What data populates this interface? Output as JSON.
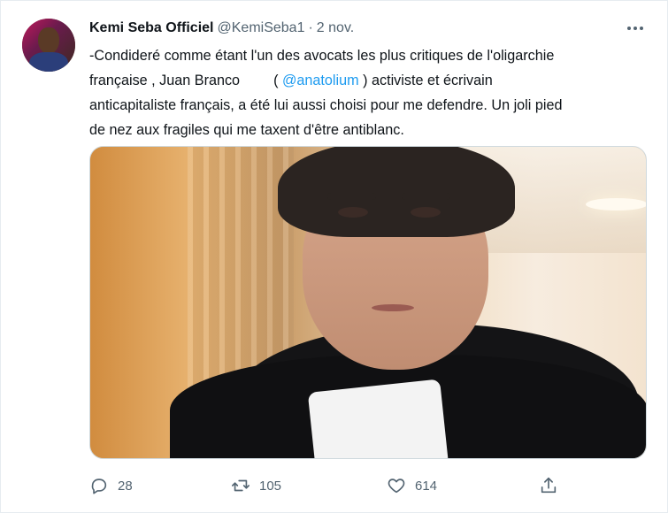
{
  "tweet": {
    "author_name": "Kemi Seba Officiel",
    "handle": "@KemiSeba1",
    "separator": "·",
    "date": "2 nov.",
    "text_lines": [
      "-Condideré comme étant l'un des avocats  les plus critiques de l'oligarchie",
      "française , Juan Branco",
      "activiste et écrivain",
      "anticapitaliste français, a été lui aussi choisi pour me defendre. Un joli pied",
      "de nez aux fragiles  qui me taxent d'être antiblanc."
    ],
    "mention_open": "(",
    "mention": "@anatolium",
    "mention_close": ")"
  },
  "actions": {
    "replies": "28",
    "retweets": "105",
    "likes": "614"
  },
  "icons": {
    "more": "more-icon",
    "reply": "reply-icon",
    "retweet": "retweet-icon",
    "like": "heart-icon",
    "share": "share-icon"
  },
  "colors": {
    "link": "#1d9bf0",
    "secondary_text": "#536471",
    "primary_text": "#0f1419"
  }
}
